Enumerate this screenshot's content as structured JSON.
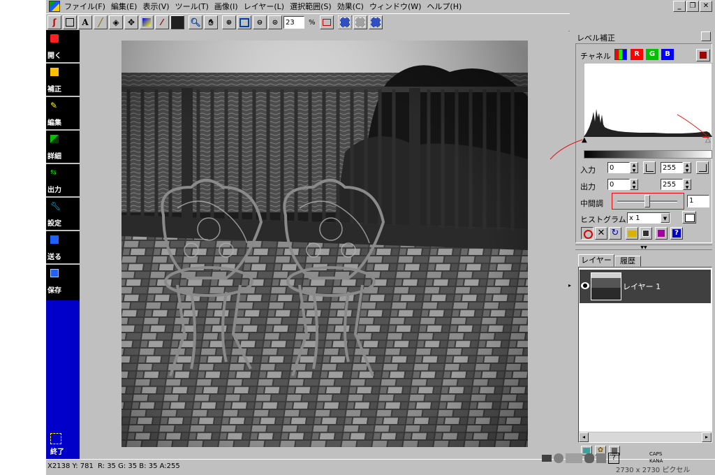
{
  "menu": {
    "items": [
      "ファイル(F)",
      "編集(E)",
      "表示(V)",
      "ツール(T)",
      "画像(I)",
      "レイヤー(L)",
      "選択範囲(S)",
      "効果(C)",
      "ウィンドウ(W)",
      "ヘルプ(H)"
    ]
  },
  "toolbar": {
    "text_tool": "A",
    "zoom_value": "23",
    "zoom_unit": "%"
  },
  "sidebar": {
    "items": [
      {
        "label": "開く",
        "color": "#ff2020"
      },
      {
        "label": "補正",
        "color": "#ffc000"
      },
      {
        "label": "編集",
        "color": "#ffff00"
      },
      {
        "label": "詳細",
        "color": "#00c000"
      },
      {
        "label": "出力",
        "color": "#00c000"
      },
      {
        "label": "設定",
        "color": "#00c0ff"
      },
      {
        "label": "送る",
        "color": "#2060ff"
      },
      {
        "label": "保存",
        "color": "#2060ff"
      }
    ],
    "exit_label": "終了"
  },
  "level_panel": {
    "title": "レベル補正",
    "channel_label": "チャネル",
    "ch_r": "R",
    "ch_g": "G",
    "ch_b": "B",
    "input_label": "入力",
    "input_low": "0",
    "input_high": "255",
    "output_label": "出力",
    "output_low": "0",
    "output_high": "255",
    "midtone_label": "中間調",
    "midtone_value": "1",
    "midtone_slider_position": 0.5,
    "histogram_label": "ヒストグラム",
    "histogram_scale": "x 1"
  },
  "layers_panel": {
    "tab_layer": "レイヤー",
    "tab_history": "履歴",
    "layer_name": "レイヤー 1"
  },
  "status": {
    "coords": "X2138 Y: 781",
    "color": "R: 35 G: 35 B: 35 A:255",
    "caps": "CAPS",
    "kana": "KANA",
    "size": "2730 x 2730 ピクセル"
  }
}
